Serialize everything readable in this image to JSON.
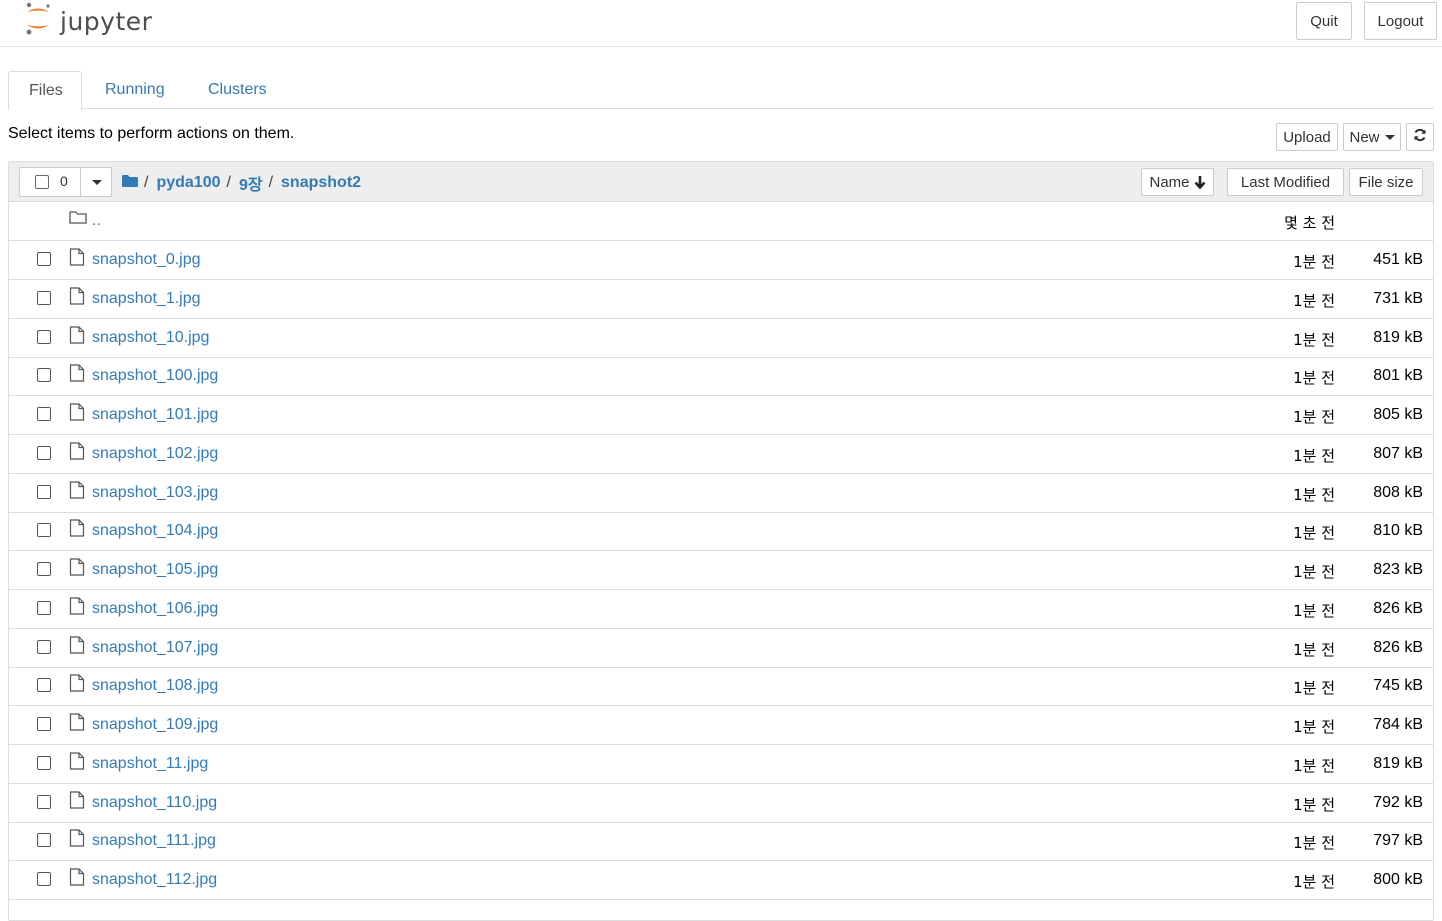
{
  "header": {
    "logo_text": "jupyter",
    "quit_label": "Quit",
    "logout_label": "Logout"
  },
  "tabs": [
    {
      "label": "Files",
      "active": true
    },
    {
      "label": "Running",
      "active": false
    },
    {
      "label": "Clusters",
      "active": false
    }
  ],
  "toolbar": {
    "message": "Select items to perform actions on them.",
    "upload_label": "Upload",
    "new_label": "New",
    "refresh_icon": "refresh-icon"
  },
  "list_header": {
    "selected_count": "0",
    "breadcrumb": [
      "pyda100",
      "9장",
      "snapshot2"
    ],
    "sort_name_label": "Name",
    "sort_modified_label": "Last Modified",
    "sort_size_label": "File size"
  },
  "parent_row": {
    "name": "..",
    "modified": "몇 초 전"
  },
  "files": [
    {
      "name": "snapshot_0.jpg",
      "modified": "1분 전",
      "size": "451 kB"
    },
    {
      "name": "snapshot_1.jpg",
      "modified": "1분 전",
      "size": "731 kB"
    },
    {
      "name": "snapshot_10.jpg",
      "modified": "1분 전",
      "size": "819 kB"
    },
    {
      "name": "snapshot_100.jpg",
      "modified": "1분 전",
      "size": "801 kB"
    },
    {
      "name": "snapshot_101.jpg",
      "modified": "1분 전",
      "size": "805 kB"
    },
    {
      "name": "snapshot_102.jpg",
      "modified": "1분 전",
      "size": "807 kB"
    },
    {
      "name": "snapshot_103.jpg",
      "modified": "1분 전",
      "size": "808 kB"
    },
    {
      "name": "snapshot_104.jpg",
      "modified": "1분 전",
      "size": "810 kB"
    },
    {
      "name": "snapshot_105.jpg",
      "modified": "1분 전",
      "size": "823 kB"
    },
    {
      "name": "snapshot_106.jpg",
      "modified": "1분 전",
      "size": "826 kB"
    },
    {
      "name": "snapshot_107.jpg",
      "modified": "1분 전",
      "size": "826 kB"
    },
    {
      "name": "snapshot_108.jpg",
      "modified": "1분 전",
      "size": "745 kB"
    },
    {
      "name": "snapshot_109.jpg",
      "modified": "1분 전",
      "size": "784 kB"
    },
    {
      "name": "snapshot_11.jpg",
      "modified": "1분 전",
      "size": "819 kB"
    },
    {
      "name": "snapshot_110.jpg",
      "modified": "1분 전",
      "size": "792 kB"
    },
    {
      "name": "snapshot_111.jpg",
      "modified": "1분 전",
      "size": "797 kB"
    },
    {
      "name": "snapshot_112.jpg",
      "modified": "1분 전",
      "size": "800 kB"
    }
  ],
  "colors": {
    "link": "#337ab7",
    "border": "#dddddd",
    "header_bg": "#eeeeee",
    "logo_orange": "#f37726"
  }
}
